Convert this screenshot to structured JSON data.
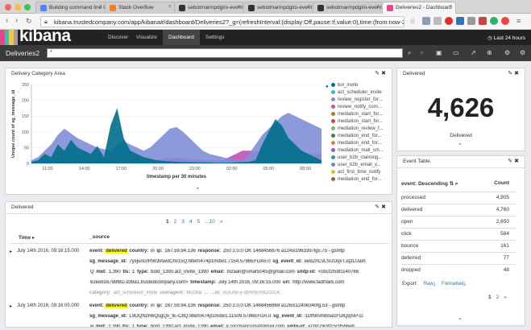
{
  "browser": {
    "tabs": [
      {
        "label": "Building command line too",
        "color": "#4b86ff",
        "left": 44,
        "width": 88
      },
      {
        "label": "Stack Overflow",
        "color": "#f48024",
        "left": 130,
        "width": 88
      },
      {
        "label": "sebotmarmpdgl/o-event",
        "color": "#333333",
        "left": 216,
        "width": 88
      },
      {
        "label": "sebotmarmpdgl/o-event",
        "color": "#333333",
        "left": 302,
        "width": 88
      },
      {
        "label": "sebotmarmpdgl/o-event",
        "color": "#333333",
        "left": 388,
        "width": 88
      },
      {
        "label": "Deliveries2 - Dashboard",
        "color": "#e8478b",
        "left": 474,
        "width": 92,
        "active": true
      }
    ],
    "url": "kibana.trustedcompany.com/app/kibana#/dashboard/Deliveries2?_g=(refreshInterval:(display:Off,pause:!f,value:0),time:(from:now-24h..."
  },
  "kibana": {
    "logo": "kibana",
    "nav": [
      "Discover",
      "Visualize",
      "Dashboard",
      "Settings"
    ],
    "active_nav": "Dashboard",
    "time_range": "Last 24 hours",
    "dashboard_name": "Deliveries2",
    "query": "*"
  },
  "panels": {
    "category": {
      "title": "Delivery Category Area"
    },
    "delivered_metric": {
      "title": "Delivered",
      "value": "4,626",
      "caption": "Delivered"
    },
    "event_table": {
      "title": "Event Table",
      "col_event": "event: Descending",
      "col_count": "Count",
      "rows": [
        {
          "event": "processed",
          "count": "4,905"
        },
        {
          "event": "delivered",
          "count": "4,760"
        },
        {
          "event": "open",
          "count": "2,650"
        },
        {
          "event": "click",
          "count": "584"
        },
        {
          "event": "bounce",
          "count": "161"
        },
        {
          "event": "deferred",
          "count": "77"
        },
        {
          "event": "dropped",
          "count": "48"
        }
      ],
      "export_label": "Export:",
      "export_raw": "Raw",
      "export_formatted": "Formatted",
      "pages": [
        "1",
        "2",
        "»"
      ]
    },
    "delivered_list": {
      "title": "Delivered",
      "pages": [
        "1",
        "2",
        "3",
        "4",
        "5",
        "...10",
        "»"
      ],
      "col_time": "Time",
      "col_source": "_source",
      "docs": [
        {
          "time": "July 14th 2016, 09:16:15.000",
          "lines": [
            [
              "event:",
              "delivered",
              "country:",
              "in",
              "ip:",
              "167.59.94.136",
              "response:",
              "250 2.0.0 OK 1468456876 a124sl1963397lgs.75 - gsmtp"
            ],
            [
              "sg_message_id:",
              "7yxjuoGIRW3lAwoChv15Q.filter0474p1mdw1.7154.5786EFDA5.0",
              "sg_event_id:",
              "ee9ZhCvLSUOqvTJqzLUam"
            ],
            [
              "Q",
              "mid:",
              "1,390",
              "tls:",
              "1",
              "type:",
              "bold_1390.act_invite_1390",
              "email:",
              "mzaari@smar5045@gmail.com",
              "smtp-id:",
              "<cbcf1f59l1140766"
            ],
            [
              "62ee816789f8D.d39a1.trustedcompany.com>",
              "timestamp:",
              "July 14th 2016, 09:16:15.000",
              "url:",
              "http://www.fadmark.com"
            ],
            [
              "category:",
              "act_scheduler_invite",
              "useragent:",
              "Mozilla",
              "...",
              "...id:",
              "AGUbv-y-dbRnERBZc0CK"
            ]
          ]
        },
        {
          "time": "July 14th 2016, 09:16:05.000",
          "lines": [
            [
              "event:",
              "delivered",
              "country:",
              "in",
              "ip:",
              "167.59.94.136",
              "response:",
              "250 2.0.0 OK 1468456869 a126sl12406340fg.53 - gsmtp"
            ],
            [
              "sg_message_id:",
              "L9OQNzR6QsgQx_tE-C8Q.filter0474p1mdw1.11509.5786EFDA.0",
              "sg_event_id:",
              "1DfN0vh8xsezFDlQqXlP-D"
            ],
            [
              "w",
              "mid:",
              "1,390",
              "tls:",
              "1",
              "type:",
              "bold_1390.act_invite_1390",
              "email:",
              "k.rocchancuris@gmail.com",
              "smtp-id:",
              "<c0d79c8f15c9566e8"
            ]
          ]
        }
      ]
    }
  },
  "chart_data": {
    "type": "area",
    "ylabel": "Unique count of sg_message_id",
    "xlabel": "timestamp per 30 minutes",
    "x_ticks": [
      "11:00",
      "14:00",
      "17:00",
      "20:00",
      "23:00",
      "02:00",
      "05:00",
      "08:00"
    ],
    "y_ticks": [
      0,
      50,
      100,
      150,
      200,
      250
    ],
    "ylim": [
      0,
      250
    ],
    "legend": [
      {
        "name": "bol_invite",
        "color": "#006e8a"
      },
      {
        "name": "act_scheduler_invite",
        "color": "#3cb4c8"
      },
      {
        "name": "review_register_for...",
        "color": "#7f8fd8"
      },
      {
        "name": "review_notify_com...",
        "color": "#c04fb2"
      },
      {
        "name": "mediation_start_for...",
        "color": "#b37a2a"
      },
      {
        "name": "mediation_start_for...",
        "color": "#c34b4b"
      },
      {
        "name": "mediation_review_f...",
        "color": "#7bbd5a"
      },
      {
        "name": "mediation_end_for...",
        "color": "#3f7b5a"
      },
      {
        "name": "mediation_end_for...",
        "color": "#d48b40"
      },
      {
        "name": "mediation_mail_sm...",
        "color": "#9b58b5"
      },
      {
        "name": "user_b2b_claiming...",
        "color": "#2a9c89"
      },
      {
        "name": "user_b2b_email_v...",
        "color": "#6a8cc2"
      },
      {
        "name": "act_first_time_notify",
        "color": "#d7bc42"
      },
      {
        "name": "mediation_end_for...",
        "color": "#8a6d3b"
      }
    ],
    "series": [
      {
        "name": "bol_invite",
        "values": [
          5,
          10,
          30,
          20,
          60,
          40,
          75,
          50,
          40,
          30,
          55,
          20,
          120,
          175,
          80,
          40,
          30,
          20,
          15,
          10,
          8,
          6,
          5,
          4,
          4,
          3,
          3,
          3,
          2,
          2,
          2,
          3,
          4,
          5,
          10,
          60,
          100,
          140,
          120,
          80,
          60,
          40,
          30,
          20,
          10
        ]
      },
      {
        "name": "review_register_for...",
        "values": [
          10,
          20,
          40,
          60,
          90,
          110,
          95,
          80,
          70,
          60,
          50,
          45,
          40,
          60,
          70,
          60,
          50,
          40,
          50,
          70,
          90,
          110,
          115,
          100,
          80,
          60,
          40,
          30,
          25,
          20,
          15,
          12,
          10,
          30,
          60,
          90,
          110,
          130,
          150,
          160,
          150,
          140,
          130,
          120,
          110
        ]
      },
      {
        "name": "review_notify_com...",
        "values": [
          0,
          0,
          0,
          5,
          5,
          8,
          10,
          10,
          8,
          6,
          5,
          5,
          6,
          8,
          10,
          10,
          8,
          8,
          10,
          12,
          14,
          16,
          18,
          16,
          14,
          12,
          10,
          10,
          10,
          10,
          20,
          30,
          40,
          40,
          40,
          35,
          30,
          30,
          30,
          30,
          30,
          30,
          30,
          30,
          30
        ]
      }
    ]
  }
}
